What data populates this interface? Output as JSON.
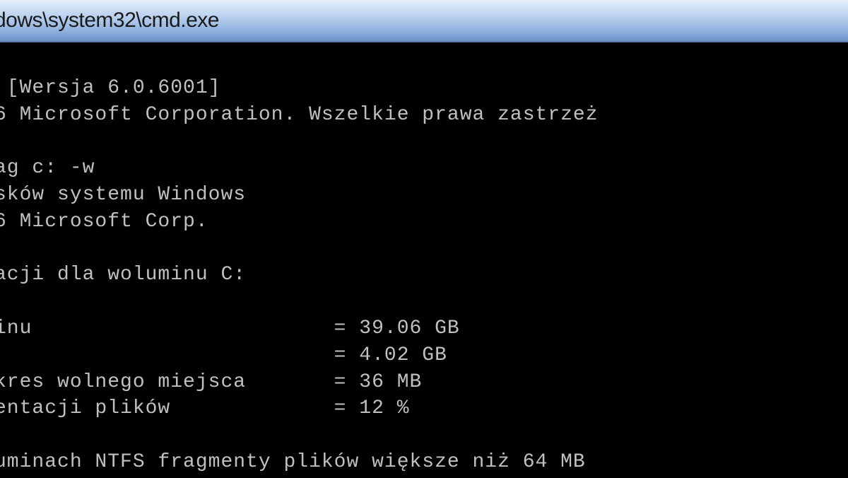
{
  "window": {
    "title": "dows\\system32\\cmd.exe"
  },
  "terminal": {
    "lines": [
      " [Wersja 6.0.6001]",
      "6 Microsoft Corporation. Wszelkie prawa zastrzeż",
      "",
      "ag c: -w",
      "sków systemu Windows",
      "6 Microsoft Corp.",
      "",
      "acji dla woluminu C:",
      "",
      "inu                        = 39.06 GB",
      "                           = 4.02 GB",
      "kres wolnego miejsca       = 36 MB",
      "entacji plików             = 12 %",
      "",
      "uminach NTFS fragmenty plików większe niż 64 MB"
    ]
  }
}
